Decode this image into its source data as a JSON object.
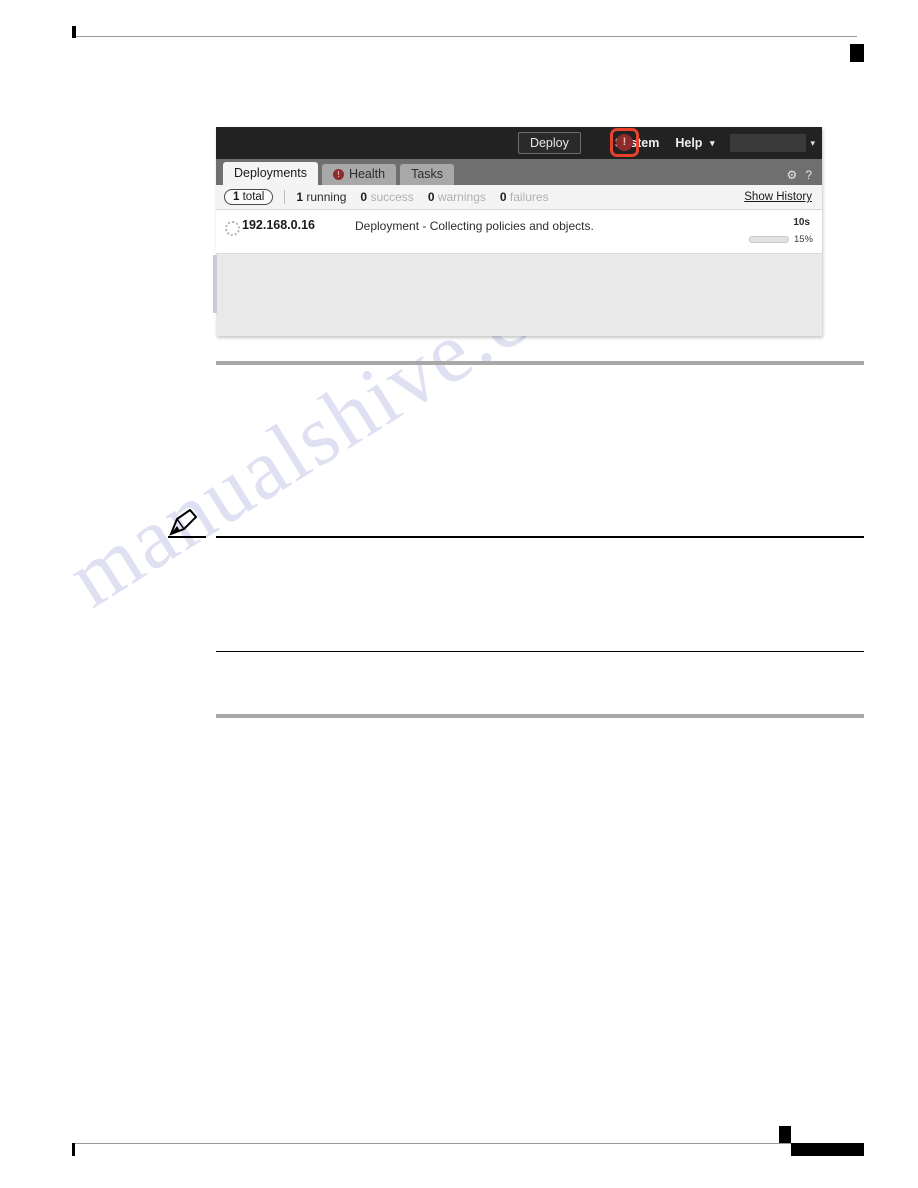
{
  "screenshot": {
    "topbar": {
      "deploy_label": "Deploy",
      "alert_icon": "alert-circle-icon",
      "alert_glyph": "!",
      "system_label": "System",
      "help_label": "Help",
      "help_caret": "▾",
      "user_value": "",
      "user_caret": "▾",
      "highlight_color": "#e8412c",
      "alert_color": "#8c2b2b",
      "bar_color": "#222222"
    },
    "tabs": [
      {
        "label": "Deployments",
        "active": true,
        "icon": ""
      },
      {
        "label": "Health",
        "active": false,
        "icon": "alert-circle-icon",
        "icon_glyph": "!"
      },
      {
        "label": "Tasks",
        "active": false,
        "icon": ""
      }
    ],
    "tab_icons": {
      "gear": "⚙",
      "help": "?"
    },
    "stats": {
      "total_count": "1",
      "total_label": "total",
      "running_count": "1",
      "running_label": "running",
      "success_count": "0",
      "success_label": "success",
      "warnings_count": "0",
      "warnings_label": "warnings",
      "failures_count": "0",
      "failures_label": "failures",
      "show_history_label": "Show History"
    },
    "deployments": [
      {
        "status_icon": "spinner-icon",
        "device": "192.168.0.16",
        "message": "Deployment - Collecting policies and objects.",
        "elapsed": "10s",
        "progress_percent": "15%",
        "progress_value": 15,
        "progress_color": "#4c72d6"
      }
    ]
  },
  "page": {
    "watermark": "manualshive.com"
  }
}
